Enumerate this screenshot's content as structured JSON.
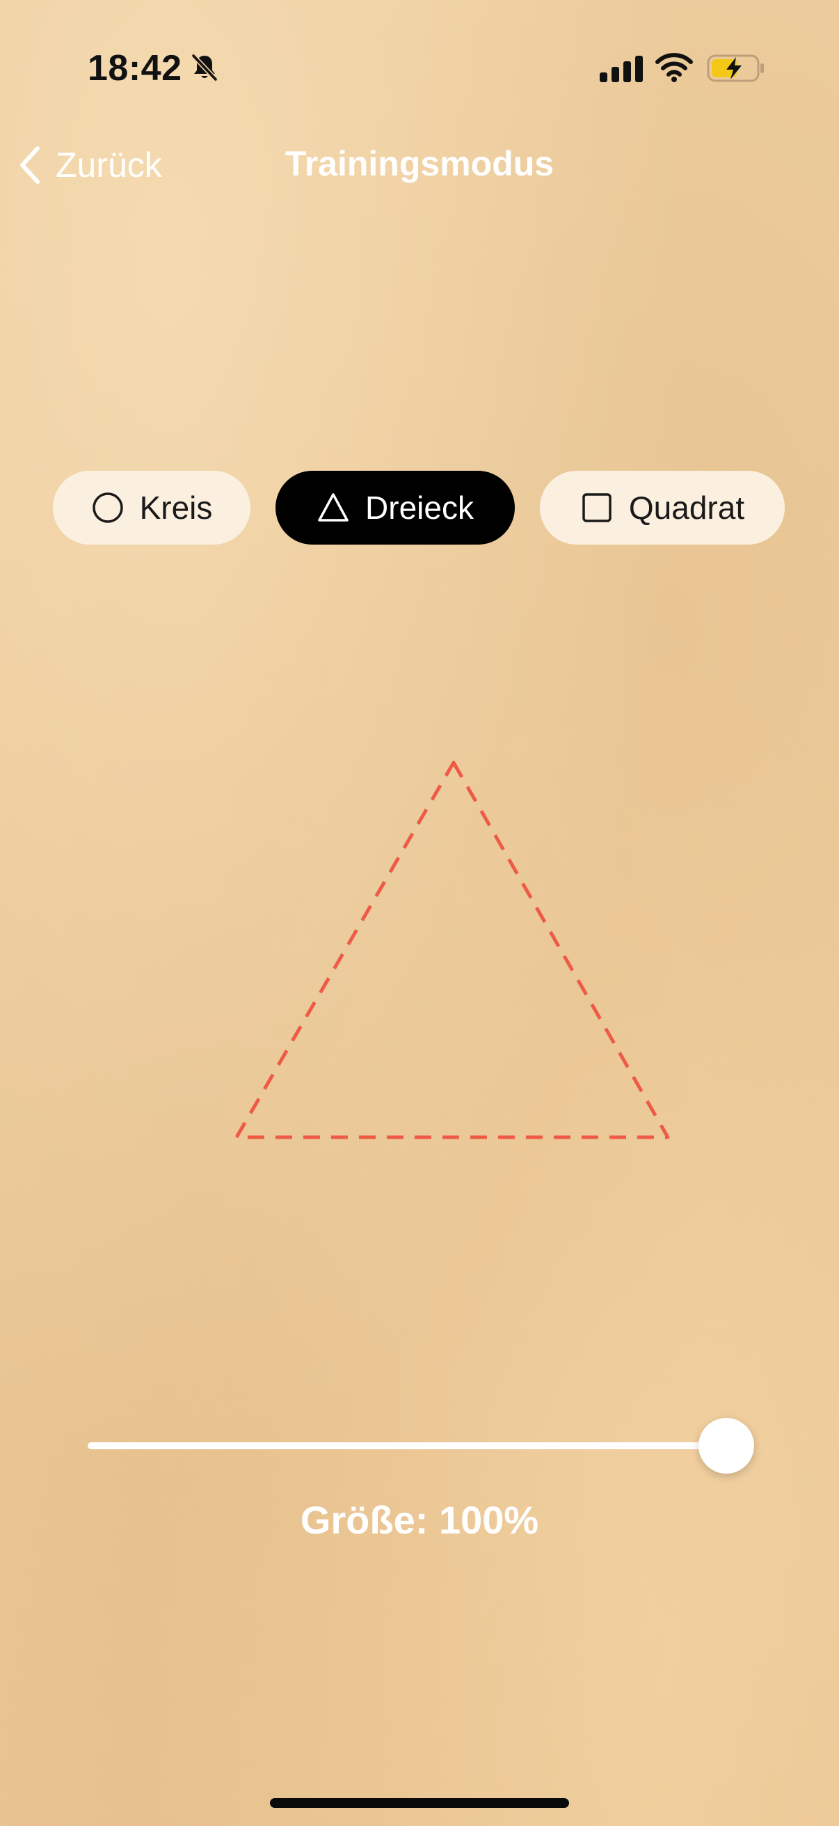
{
  "status_bar": {
    "time": "18:42",
    "icons": [
      "bell-slash-icon",
      "cellular-signal-icon",
      "wifi-icon",
      "battery-charging-icon"
    ],
    "battery_accent": "#f4c817"
  },
  "nav": {
    "back_label": "Zurück",
    "title": "Trainingsmodus"
  },
  "shape_selector": {
    "selected": "triangle",
    "options": [
      {
        "id": "circle",
        "icon": "circle-outline-icon",
        "label": "Kreis"
      },
      {
        "id": "triangle",
        "icon": "triangle-outline-icon",
        "label": "Dreieck"
      },
      {
        "id": "square",
        "icon": "square-outline-icon",
        "label": "Quadrat"
      }
    ]
  },
  "canvas": {
    "shape": "triangle",
    "stroke_color": "#ee5a45",
    "stroke_style": "dashed"
  },
  "size": {
    "label": "Größe: 100%",
    "value_fraction": 1.0
  },
  "colors": {
    "background": "#edcd9e",
    "active_button": "#000000",
    "inactive_button": "#fbf0e0",
    "text_light": "#ffffff"
  }
}
